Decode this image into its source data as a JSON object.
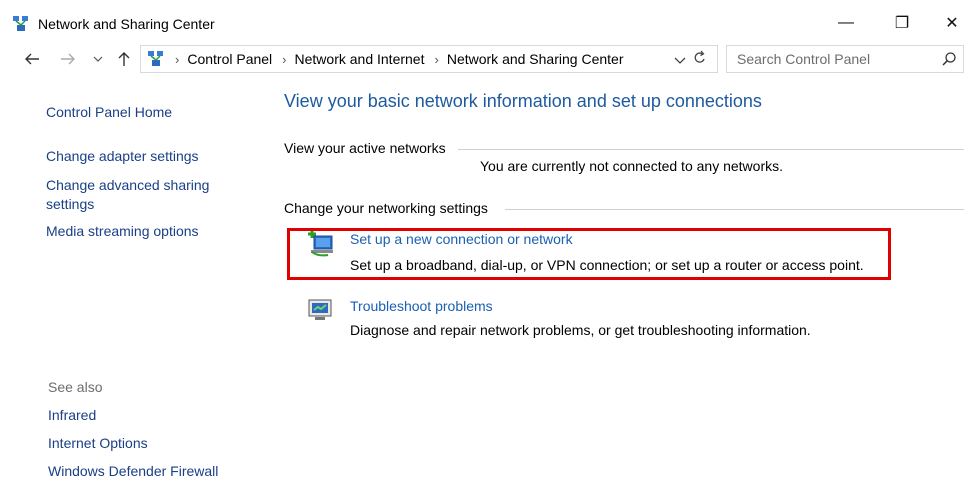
{
  "window": {
    "title": "Network and Sharing Center",
    "minimize_glyph": "—",
    "restore_glyph": "❐",
    "close_glyph": "✕"
  },
  "nav": {
    "back_icon": "back-arrow-icon",
    "forward_icon": "forward-arrow-icon",
    "up_icon": "up-arrow-icon"
  },
  "address": {
    "segments": [
      "Control Panel",
      "Network and Internet",
      "Network and Sharing Center"
    ],
    "separator": "›"
  },
  "search": {
    "placeholder": "Search Control Panel"
  },
  "left_pane": {
    "home": "Control Panel Home",
    "links": [
      "Change adapter settings",
      "Change advanced sharing settings",
      "Media streaming options"
    ],
    "see_also_heading": "See also",
    "see_also": [
      "Infrared",
      "Internet Options",
      "Windows Defender Firewall"
    ]
  },
  "main": {
    "title": "View your basic network information and set up connections",
    "active_heading": "View your active networks",
    "active_status": "You are currently not connected to any networks.",
    "change_heading": "Change your networking settings",
    "tasks": [
      {
        "title": "Set up a new connection or network",
        "desc": "Set up a broadband, dial-up, or VPN connection; or set up a router or access point.",
        "icon": "new-connection-icon"
      },
      {
        "title": "Troubleshoot problems",
        "desc": "Diagnose and repair network problems, or get troubleshooting information.",
        "icon": "troubleshoot-icon"
      }
    ]
  },
  "colors": {
    "link": "#1a5fb4",
    "title": "#1e5aa0",
    "highlight": "#e00000"
  }
}
